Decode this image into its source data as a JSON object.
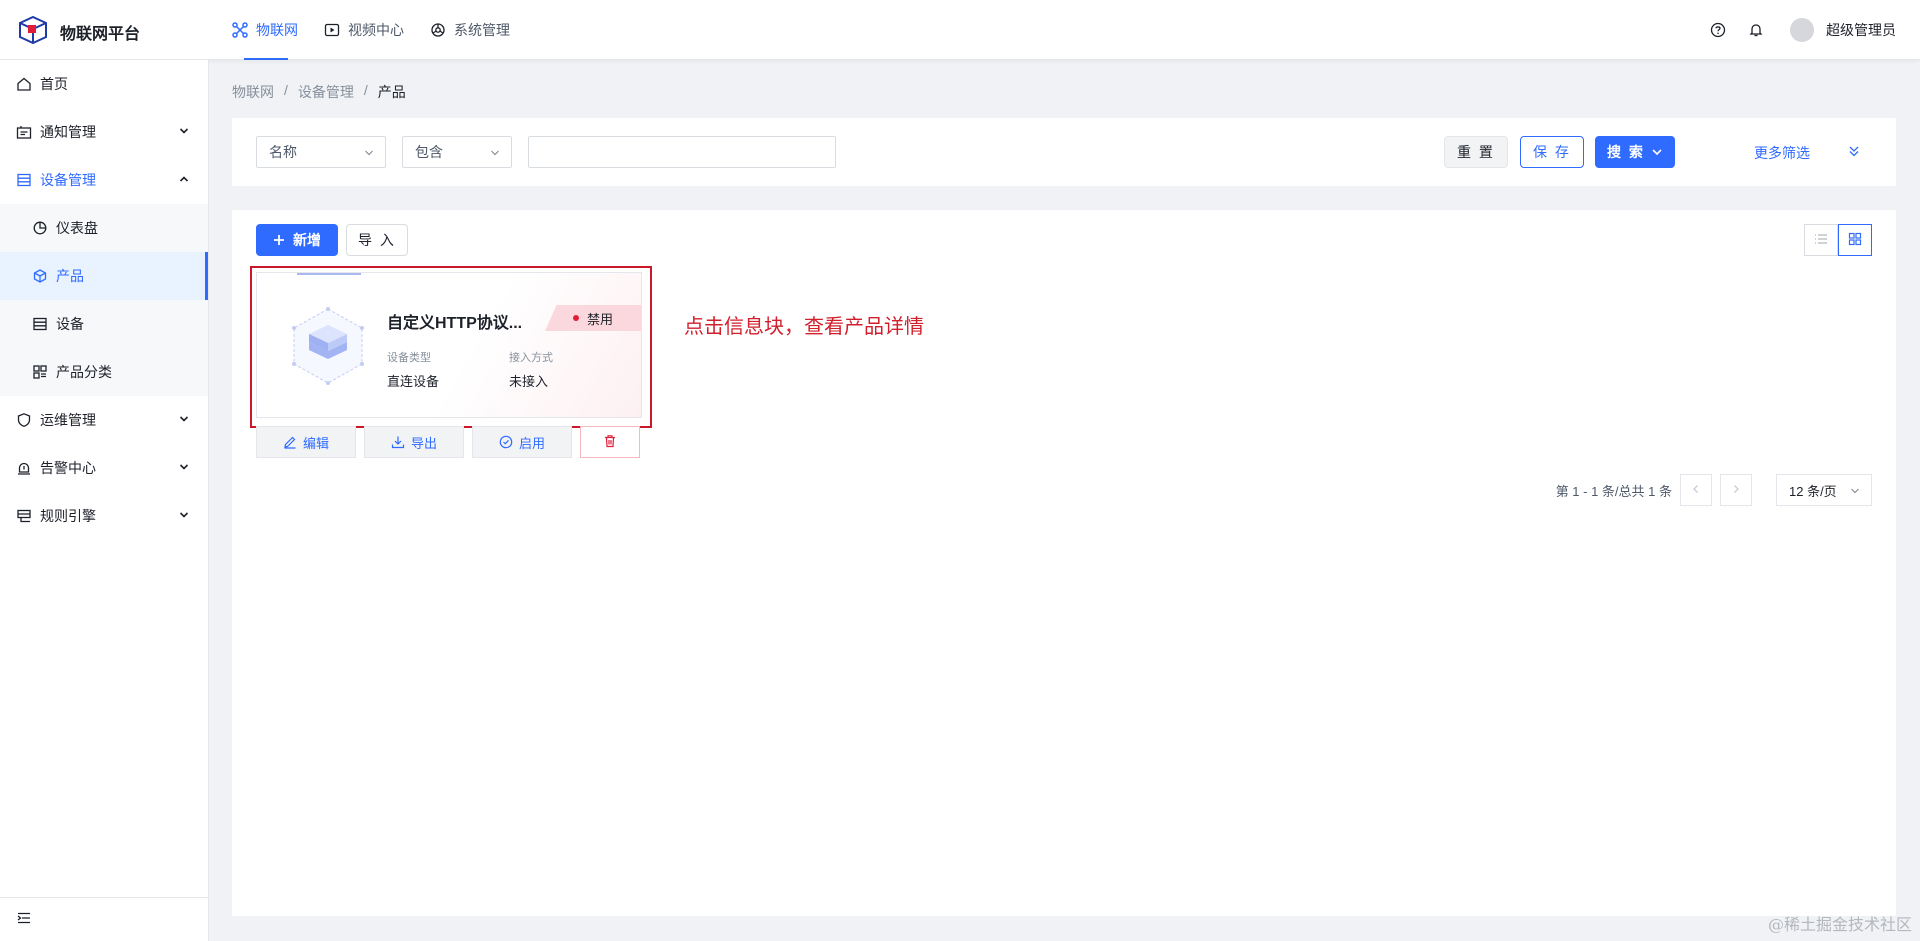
{
  "app": {
    "title": "物联网平台"
  },
  "topnav": [
    {
      "label": "物联网",
      "icon": "iot-icon",
      "active": true
    },
    {
      "label": "视频中心",
      "icon": "video-icon"
    },
    {
      "label": "系统管理",
      "icon": "settings-icon"
    }
  ],
  "header": {
    "username": "超级管理员"
  },
  "sidebar": {
    "items": [
      {
        "label": "首页",
        "icon": "home-icon"
      },
      {
        "label": "通知管理",
        "icon": "notification-icon"
      },
      {
        "label": "设备管理",
        "icon": "device-icon"
      },
      {
        "label": "仪表盘",
        "icon": "dashboard-icon"
      },
      {
        "label": "产品",
        "icon": "product-icon"
      },
      {
        "label": "设备",
        "icon": "device-list-icon"
      },
      {
        "label": "产品分类",
        "icon": "category-icon"
      },
      {
        "label": "运维管理",
        "icon": "ops-icon"
      },
      {
        "label": "告警中心",
        "icon": "alarm-icon"
      },
      {
        "label": "规则引擎",
        "icon": "rule-icon"
      }
    ]
  },
  "breadcrumb": {
    "items": [
      "物联网",
      "设备管理",
      "产品"
    ],
    "separator": "/"
  },
  "filter": {
    "field_select": "名称",
    "operator_select": "包含",
    "value": "",
    "reset_label": "重 置",
    "save_label": "保 存",
    "search_label": "搜 索",
    "more_filters_label": "更多筛选"
  },
  "toolbar": {
    "add_label": "新增",
    "import_label": "导 入"
  },
  "card": {
    "title": "自定义HTTP协议...",
    "status": "禁用",
    "device_type_label": "设备类型",
    "device_type_value": "直连设备",
    "access_label": "接入方式",
    "access_value": "未接入"
  },
  "card_actions": {
    "edit_label": "编辑",
    "export_label": "导出",
    "enable_label": "启用"
  },
  "annotation": "点击信息块，查看产品详情",
  "pagination": {
    "summary": "第 1 - 1 条/总共 1 条",
    "page_size": "12 条/页"
  },
  "watermark": "@稀土掘金技术社区",
  "colors": {
    "primary": "#2f6bff",
    "danger": "#d11f2c",
    "status_disabled": "#e11d3a"
  }
}
